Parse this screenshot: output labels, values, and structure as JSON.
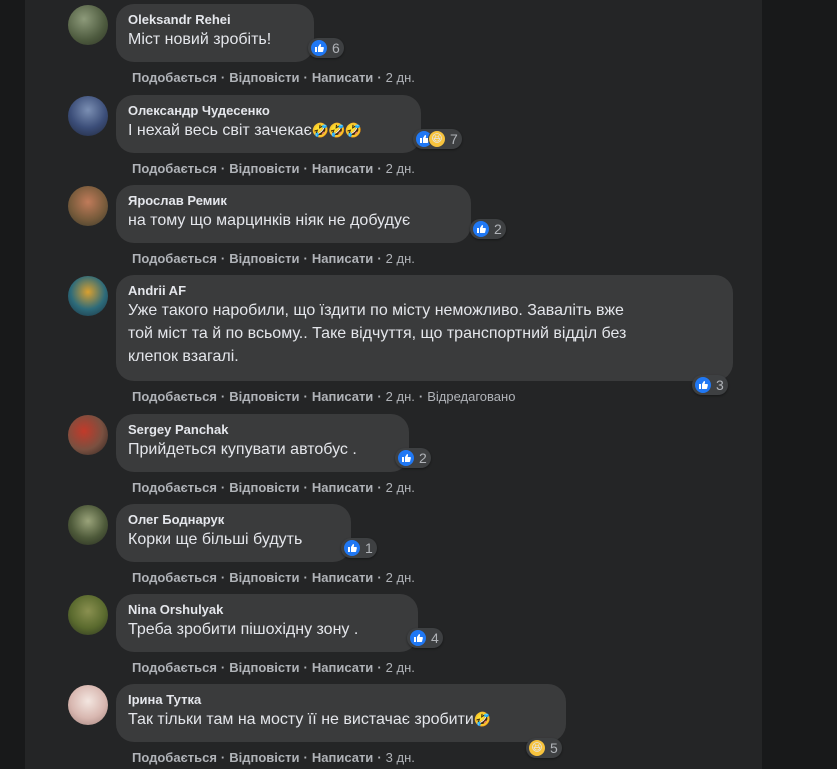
{
  "actions": {
    "like": "Подобається",
    "reply": "Відповісти",
    "write": "Написати",
    "sep": "·"
  },
  "comments": [
    {
      "author": "Oleksandr Rehei",
      "text": "Міст новий зробіть!",
      "emoji": "",
      "reaction_count": "6",
      "laugh": false,
      "time": "2 дн.",
      "edited": ""
    },
    {
      "author": "Олександр Чудесенко",
      "text": "І нехай весь світ зачекає",
      "emoji": "🤣🤣🤣",
      "reaction_count": "7",
      "laugh": true,
      "time": "2 дн.",
      "edited": ""
    },
    {
      "author": "Ярослав Ремик",
      "text": "на тому що марцинків ніяк не добудує",
      "emoji": "",
      "reaction_count": "2",
      "laugh": false,
      "time": "2 дн.",
      "edited": ""
    },
    {
      "author": "Andrii AF",
      "text_lines": [
        "Уже такого наробили, що їздити по місту неможливо. Заваліть вже",
        "той міст та й по всьому.. Таке відчуття, що транспортний відділ без",
        "клепок взагалі."
      ],
      "emoji": "",
      "reaction_count": "3",
      "laugh": false,
      "time": "2 дн.",
      "edited": "Відредаговано"
    },
    {
      "author": "Sergey Panchak",
      "text": "Прийдеться купувати автобус .",
      "emoji": "",
      "reaction_count": "2",
      "laugh": false,
      "time": "2 дн.",
      "edited": ""
    },
    {
      "author": "Олег Боднарук",
      "text": "Корки ще більші будуть",
      "emoji": "",
      "reaction_count": "1",
      "laugh": false,
      "time": "2 дн.",
      "edited": ""
    },
    {
      "author": "Nina Orshulyak",
      "text": "Треба зробити пішохідну зону .",
      "emoji": "",
      "reaction_count": "4",
      "laugh": false,
      "time": "2 дн.",
      "edited": ""
    },
    {
      "author": "Ірина Тутка",
      "text": "Так тільки там на мосту її не вистачає зробити",
      "emoji": "🤣",
      "reaction_count": "5",
      "laugh": true,
      "time": "3 дн.",
      "edited": ""
    }
  ],
  "colors": {
    "bubble": "#3a3b3c",
    "panel": "#242526",
    "like": "#2078f4",
    "muted": "#b0b3b8"
  },
  "icons": {
    "like": "thumbs-up-icon",
    "laugh": "laughing-face-icon"
  }
}
